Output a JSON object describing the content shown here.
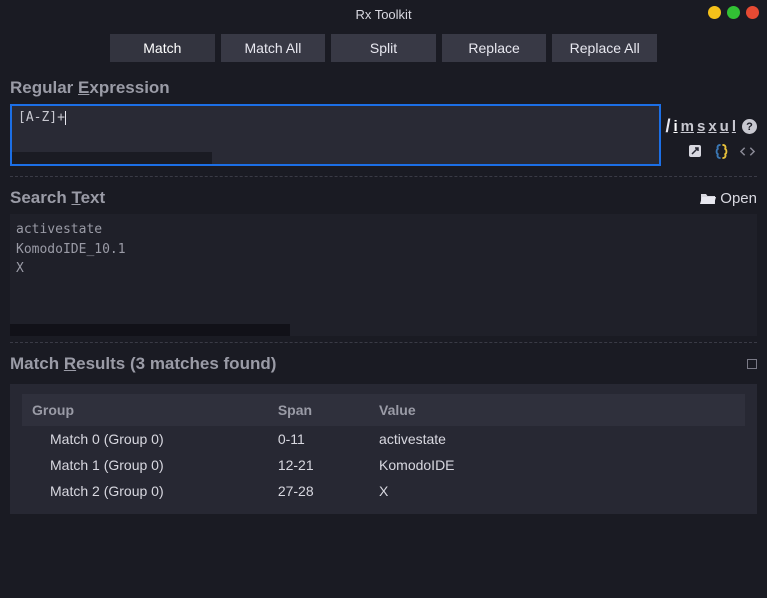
{
  "window": {
    "title": "Rx Toolkit"
  },
  "tabs": {
    "match": "Match",
    "matchAll": "Match All",
    "split": "Split",
    "replace": "Replace",
    "replaceAll": "Replace All"
  },
  "sections": {
    "regexLabelPre": "Regular ",
    "regexLabelU": "E",
    "regexLabelPost": "xpression",
    "searchLabelPre": "Search ",
    "searchLabelU": "T",
    "searchLabelPost": "ext",
    "resultsLabelPre": "Match ",
    "resultsLabelU": "R",
    "resultsLabelPost": "esults (3 matches found)"
  },
  "regex": {
    "pattern": "[A-Z]+"
  },
  "flags": {
    "i": "i",
    "m": "m",
    "s": "s",
    "x": "x",
    "u": "u",
    "l": "l"
  },
  "openLabel": "Open",
  "searchText": "activestate\nKomodoIDE_10.1\nX",
  "resultsHeaders": {
    "group": "Group",
    "span": "Span",
    "value": "Value"
  },
  "results": [
    {
      "group": "Match 0 (Group 0)",
      "span": "0-11",
      "value": "activestate"
    },
    {
      "group": "Match 1 (Group 0)",
      "span": "12-21",
      "value": "KomodoIDE"
    },
    {
      "group": "Match 2 (Group 0)",
      "span": "27-28",
      "value": "X"
    }
  ]
}
